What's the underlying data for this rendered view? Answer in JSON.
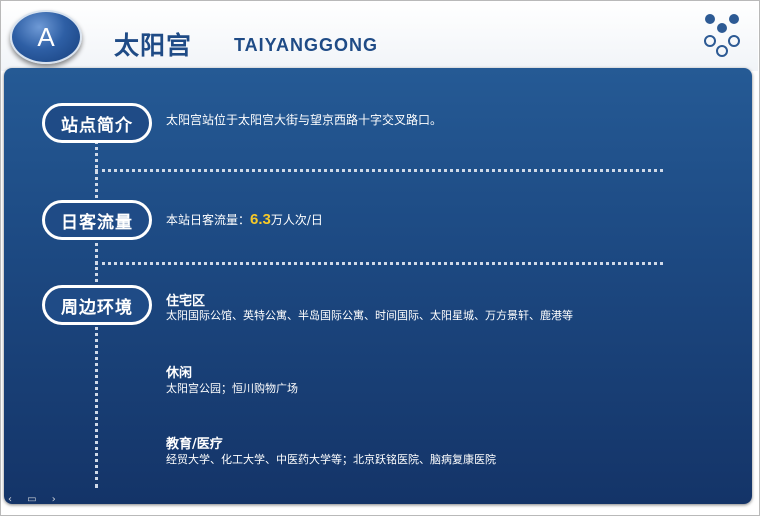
{
  "header": {
    "badge_letter": "A",
    "title_zh": "太阳宫",
    "title_en": "TAIYANGGONG"
  },
  "sections": {
    "intro": {
      "label": "站点简介",
      "text": "太阳宫站位于太阳宫大街与望京西路十字交叉路口。"
    },
    "flow": {
      "label": "日客流量",
      "prefix": "本站日客流量：",
      "value": "6.3",
      "suffix": "万人次/日"
    },
    "surroundings": {
      "label": "周边环境",
      "groups": [
        {
          "title": "住宅区",
          "text": "太阳国际公馆、英特公寓、半岛国际公寓、时间国际、太阳星城、万方景轩、鹿港等"
        },
        {
          "title": "休闲",
          "text": "太阳宫公园；恒川购物广场"
        },
        {
          "title": "教育/医疗",
          "text": "经贸大学、化工大学、中医药大学等；北京跃铭医院、脑病复康医院"
        }
      ]
    }
  },
  "colors": {
    "panel": "#1d4a83",
    "highlight": "#f6c928",
    "title": "#1f4b86"
  },
  "icons": [
    "logo-dots-icon"
  ]
}
